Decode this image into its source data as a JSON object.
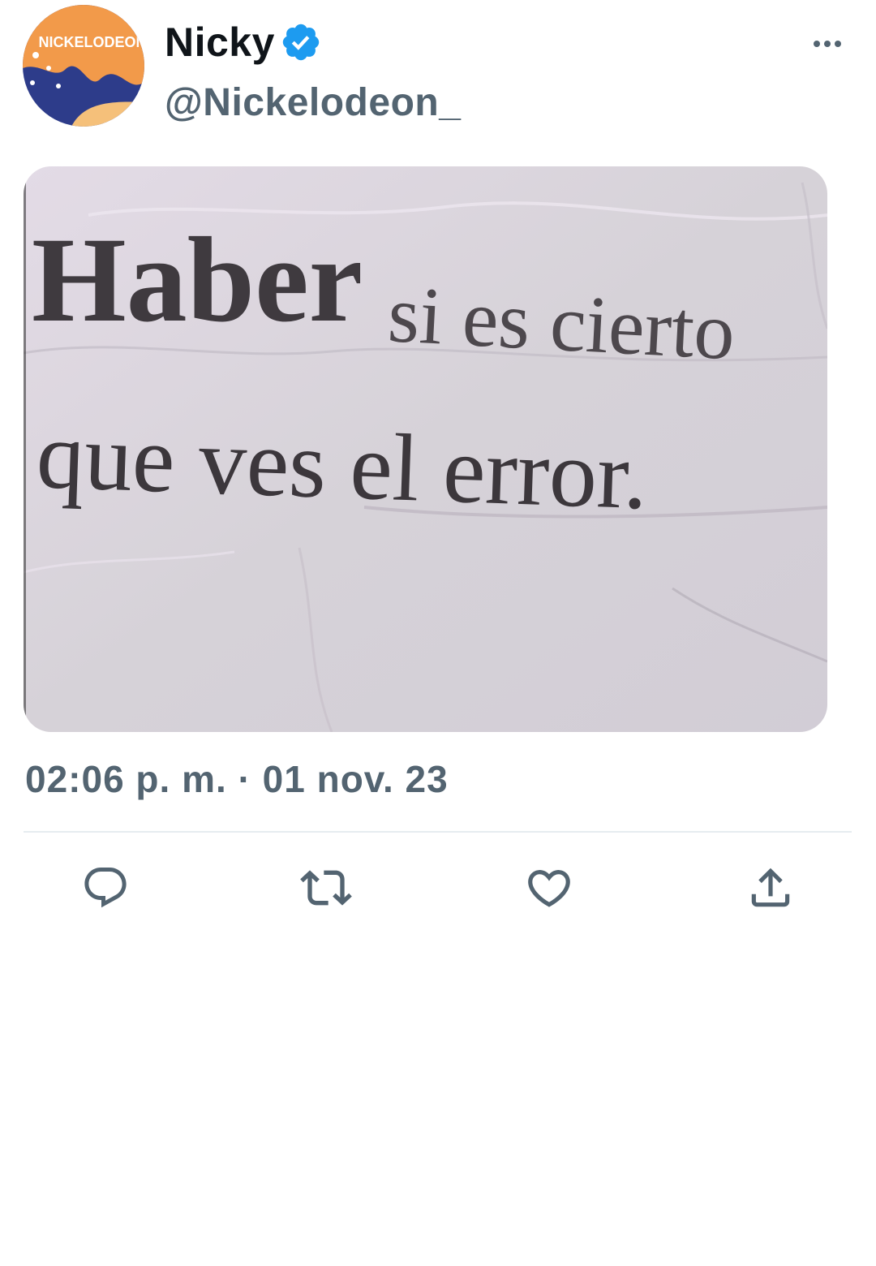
{
  "tweet": {
    "author": {
      "display_name": "Nicky",
      "handle": "@Nickelodeon_",
      "verified": true,
      "avatar_label": "NICKELODEON"
    },
    "media": {
      "line1_big": "Haber",
      "line1_rest": "si es cierto",
      "line2": "que ves el error."
    },
    "timestamp": "02:06 p. m. · 01 nov. 23"
  },
  "icons": {
    "more": "more-horizontal-icon",
    "verified": "verified-badge-icon",
    "reply": "reply-icon",
    "retweet": "retweet-icon",
    "like": "heart-icon",
    "share": "share-icon"
  },
  "colors": {
    "text_primary": "#0f1419",
    "text_secondary": "#536471",
    "verified_blue": "#1d9bf0",
    "divider": "#e6ecf0",
    "paper": "#d9d3da"
  }
}
